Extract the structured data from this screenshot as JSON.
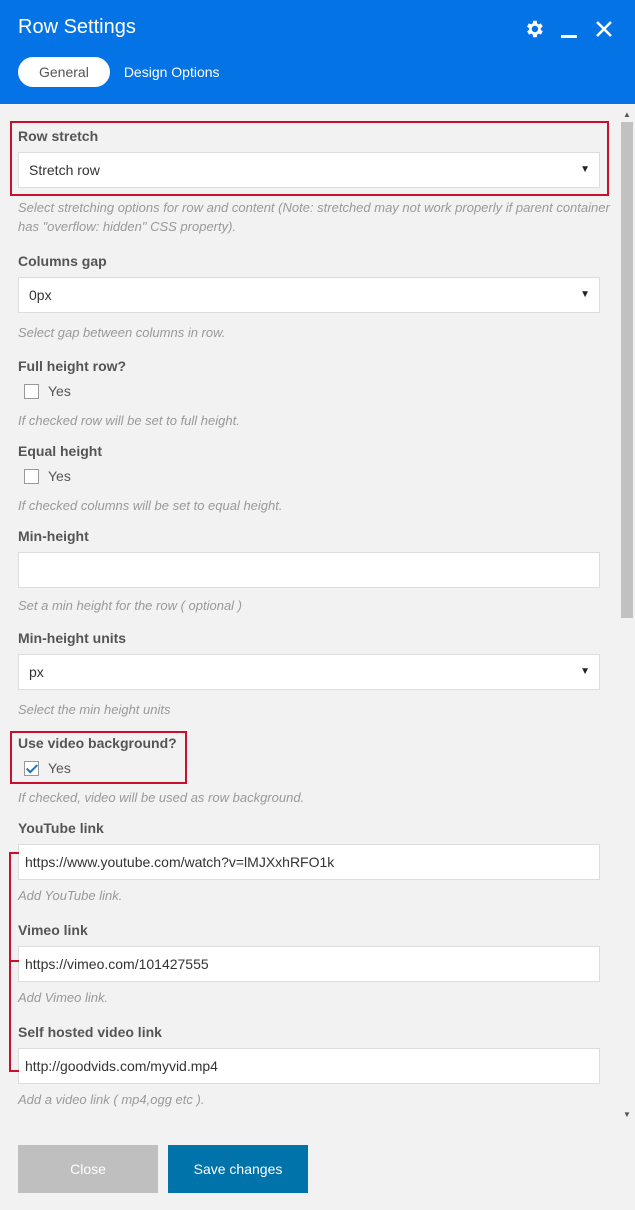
{
  "dialog": {
    "title": "Row Settings",
    "tabs": [
      "General",
      "Design Options"
    ]
  },
  "fields": {
    "row_stretch": {
      "label": "Row stretch",
      "value": "Stretch row",
      "help": "Select stretching options for row and content (Note: stretched may not work properly if parent container has \"overflow: hidden\" CSS property)."
    },
    "columns_gap": {
      "label": "Columns gap",
      "value": "0px",
      "help": "Select gap between columns in row."
    },
    "full_height": {
      "label": "Full height row?",
      "option": "Yes",
      "checked": false,
      "help": "If checked row will be set to full height."
    },
    "equal_height": {
      "label": "Equal height",
      "option": "Yes",
      "checked": false,
      "help": "If checked columns will be set to equal height."
    },
    "min_height": {
      "label": "Min-height",
      "value": "",
      "help": "Set a min height for the row ( optional )"
    },
    "min_height_units": {
      "label": "Min-height units",
      "value": "px",
      "help": "Select the min height units"
    },
    "video_bg": {
      "label": "Use video background?",
      "option": "Yes",
      "checked": true,
      "help": "If checked, video will be used as row background."
    },
    "youtube": {
      "label": "YouTube link",
      "value": "https://www.youtube.com/watch?v=lMJXxhRFO1k",
      "help": "Add YouTube link."
    },
    "vimeo": {
      "label": "Vimeo link",
      "value": "https://vimeo.com/101427555",
      "help": "Add Vimeo link."
    },
    "self_hosted": {
      "label": "Self hosted video link",
      "value": "http://goodvids.com/myvid.mp4",
      "help": "Add a video link ( mp4,ogg etc )."
    }
  },
  "buttons": {
    "close": "Close",
    "save": "Save changes"
  },
  "colors": {
    "header": "#0473e5",
    "highlight": "#c8102e",
    "save": "#0073aa",
    "close": "#bfbfbf"
  },
  "icons": [
    "gear-icon",
    "minimize-icon",
    "close-icon",
    "dropdown-arrow-icon",
    "checkmark-icon"
  ]
}
